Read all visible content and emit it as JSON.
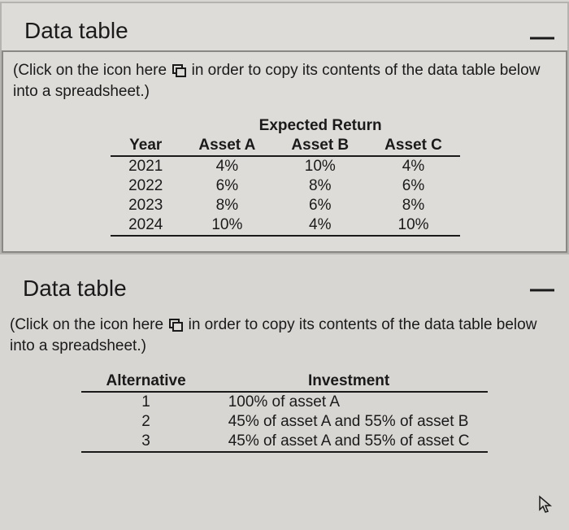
{
  "minimize_label": "—",
  "section1": {
    "title": "Data table",
    "instruction_prefix": "(Click on the icon here",
    "instruction_suffix": "in order to copy its contents of the data table below into a spreadsheet.)",
    "table": {
      "super_header": "Expected Return",
      "headers": [
        "Year",
        "Asset A",
        "Asset B",
        "Asset C"
      ],
      "rows": [
        [
          "2021",
          "4%",
          "10%",
          "4%"
        ],
        [
          "2022",
          "6%",
          "8%",
          "6%"
        ],
        [
          "2023",
          "8%",
          "6%",
          "8%"
        ],
        [
          "2024",
          "10%",
          "4%",
          "10%"
        ]
      ]
    }
  },
  "section2": {
    "title": "Data table",
    "instruction_prefix": "(Click on the icon here",
    "instruction_suffix": "in order to copy its contents of the data table below into a spreadsheet.)",
    "table": {
      "headers": [
        "Alternative",
        "Investment"
      ],
      "rows": [
        [
          "1",
          "100% of asset A"
        ],
        [
          "2",
          "45% of asset A and 55% of asset B"
        ],
        [
          "3",
          "45% of asset A and 55% of asset C"
        ]
      ]
    }
  },
  "chart_data": [
    {
      "type": "table",
      "title": "Expected Return",
      "categories": [
        "2021",
        "2022",
        "2023",
        "2024"
      ],
      "series": [
        {
          "name": "Asset A",
          "values": [
            4,
            6,
            8,
            10
          ]
        },
        {
          "name": "Asset B",
          "values": [
            10,
            8,
            6,
            4
          ]
        },
        {
          "name": "Asset C",
          "values": [
            4,
            6,
            8,
            10
          ]
        }
      ]
    },
    {
      "type": "table",
      "title": "Alternatives",
      "rows": [
        {
          "alternative": 1,
          "investment": "100% of asset A"
        },
        {
          "alternative": 2,
          "investment": "45% of asset A and 55% of asset B"
        },
        {
          "alternative": 3,
          "investment": "45% of asset A and 55% of asset C"
        }
      ]
    }
  ]
}
